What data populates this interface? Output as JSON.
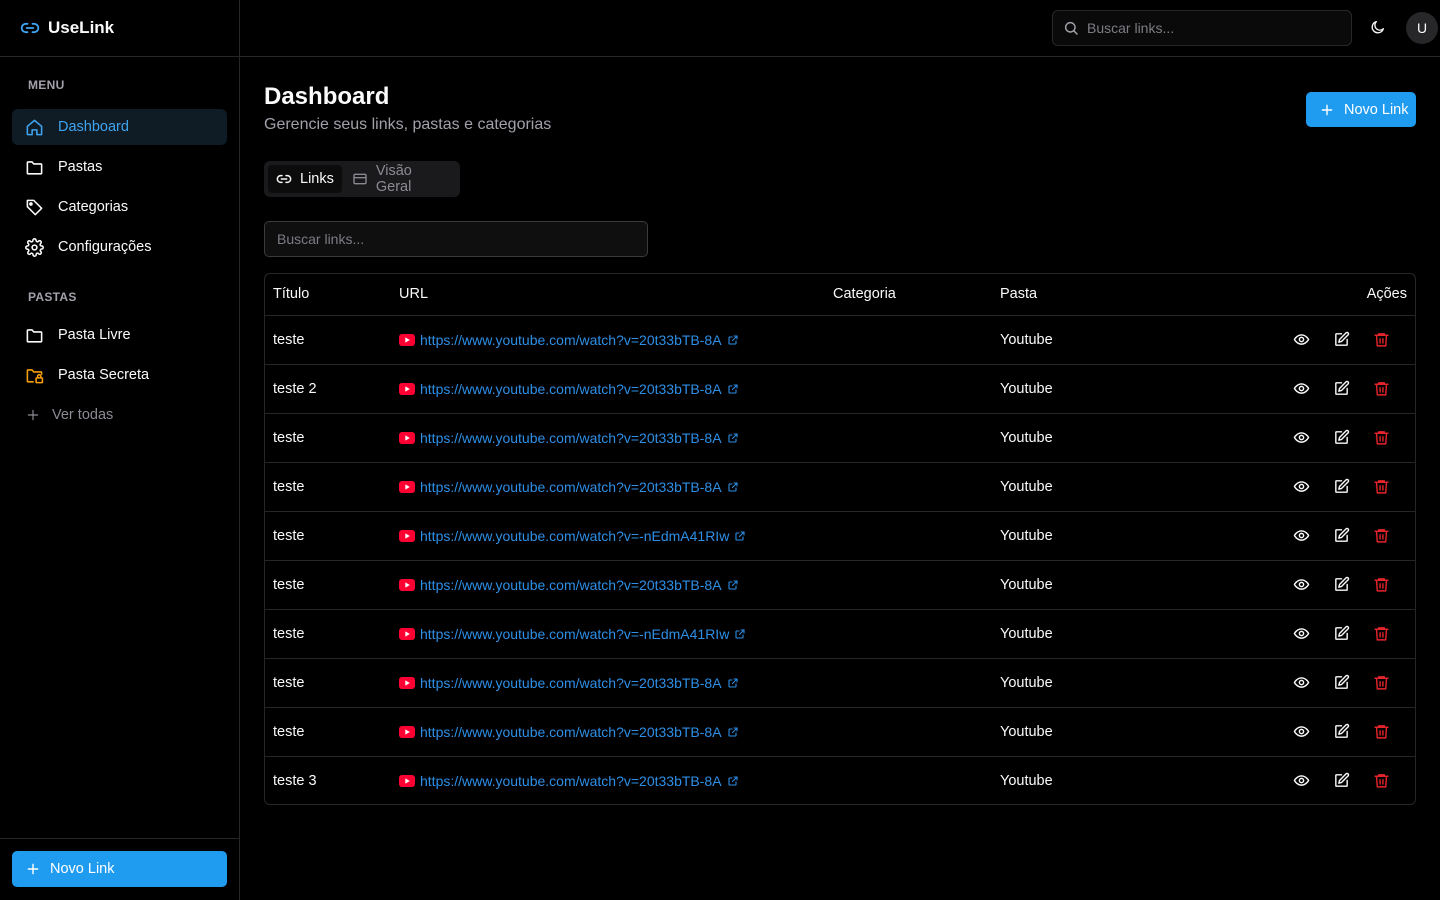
{
  "app": {
    "name": "UseLink"
  },
  "colors": {
    "accent": "#1f9bf0",
    "link": "#2e8fe6",
    "danger": "#e5242b",
    "folder_secret": "#f59e0b",
    "youtube": "#ff0033"
  },
  "sidebar": {
    "menu_label": "MENU",
    "menu_items": [
      {
        "label": "Dashboard",
        "icon": "home-icon",
        "active": true
      },
      {
        "label": "Pastas",
        "icon": "folder-icon"
      },
      {
        "label": "Categorias",
        "icon": "tag-icon"
      },
      {
        "label": "Configurações",
        "icon": "gear-icon"
      }
    ],
    "folders_label": "PASTAS",
    "folders": [
      {
        "label": "Pasta Livre",
        "icon": "folder-icon"
      },
      {
        "label": "Pasta Secreta",
        "icon": "folder-lock-icon"
      }
    ],
    "see_all": "Ver todas",
    "new_link": "Novo Link"
  },
  "header": {
    "search_placeholder": "Buscar links...",
    "avatar_initial": "U"
  },
  "main": {
    "title": "Dashboard",
    "subtitle": "Gerencie seus links, pastas e categorias",
    "new_link": "Novo Link",
    "tabs": [
      {
        "label": "Links",
        "icon": "link-icon",
        "active": true
      },
      {
        "label": "Visão Geral",
        "icon": "card-icon"
      }
    ],
    "filter_placeholder": "Buscar links...",
    "table": {
      "headers": [
        "Título",
        "URL",
        "Categoria",
        "Pasta",
        "Ações"
      ],
      "rows": [
        {
          "title": "teste",
          "url": "https://www.youtube.com/watch?v=20t33bTB-8A",
          "category": "",
          "folder": "Youtube"
        },
        {
          "title": "teste 2",
          "url": "https://www.youtube.com/watch?v=20t33bTB-8A",
          "category": "",
          "folder": "Youtube"
        },
        {
          "title": "teste",
          "url": "https://www.youtube.com/watch?v=20t33bTB-8A",
          "category": "",
          "folder": "Youtube"
        },
        {
          "title": "teste",
          "url": "https://www.youtube.com/watch?v=20t33bTB-8A",
          "category": "",
          "folder": "Youtube"
        },
        {
          "title": "teste",
          "url": "https://www.youtube.com/watch?v=-nEdmA41RIw",
          "category": "",
          "folder": "Youtube"
        },
        {
          "title": "teste",
          "url": "https://www.youtube.com/watch?v=20t33bTB-8A",
          "category": "",
          "folder": "Youtube"
        },
        {
          "title": "teste",
          "url": "https://www.youtube.com/watch?v=-nEdmA41RIw",
          "category": "",
          "folder": "Youtube"
        },
        {
          "title": "teste",
          "url": "https://www.youtube.com/watch?v=20t33bTB-8A",
          "category": "",
          "folder": "Youtube"
        },
        {
          "title": "teste",
          "url": "https://www.youtube.com/watch?v=20t33bTB-8A",
          "category": "",
          "folder": "Youtube"
        },
        {
          "title": "teste 3",
          "url": "https://www.youtube.com/watch?v=20t33bTB-8A",
          "category": "",
          "folder": "Youtube"
        }
      ]
    }
  }
}
